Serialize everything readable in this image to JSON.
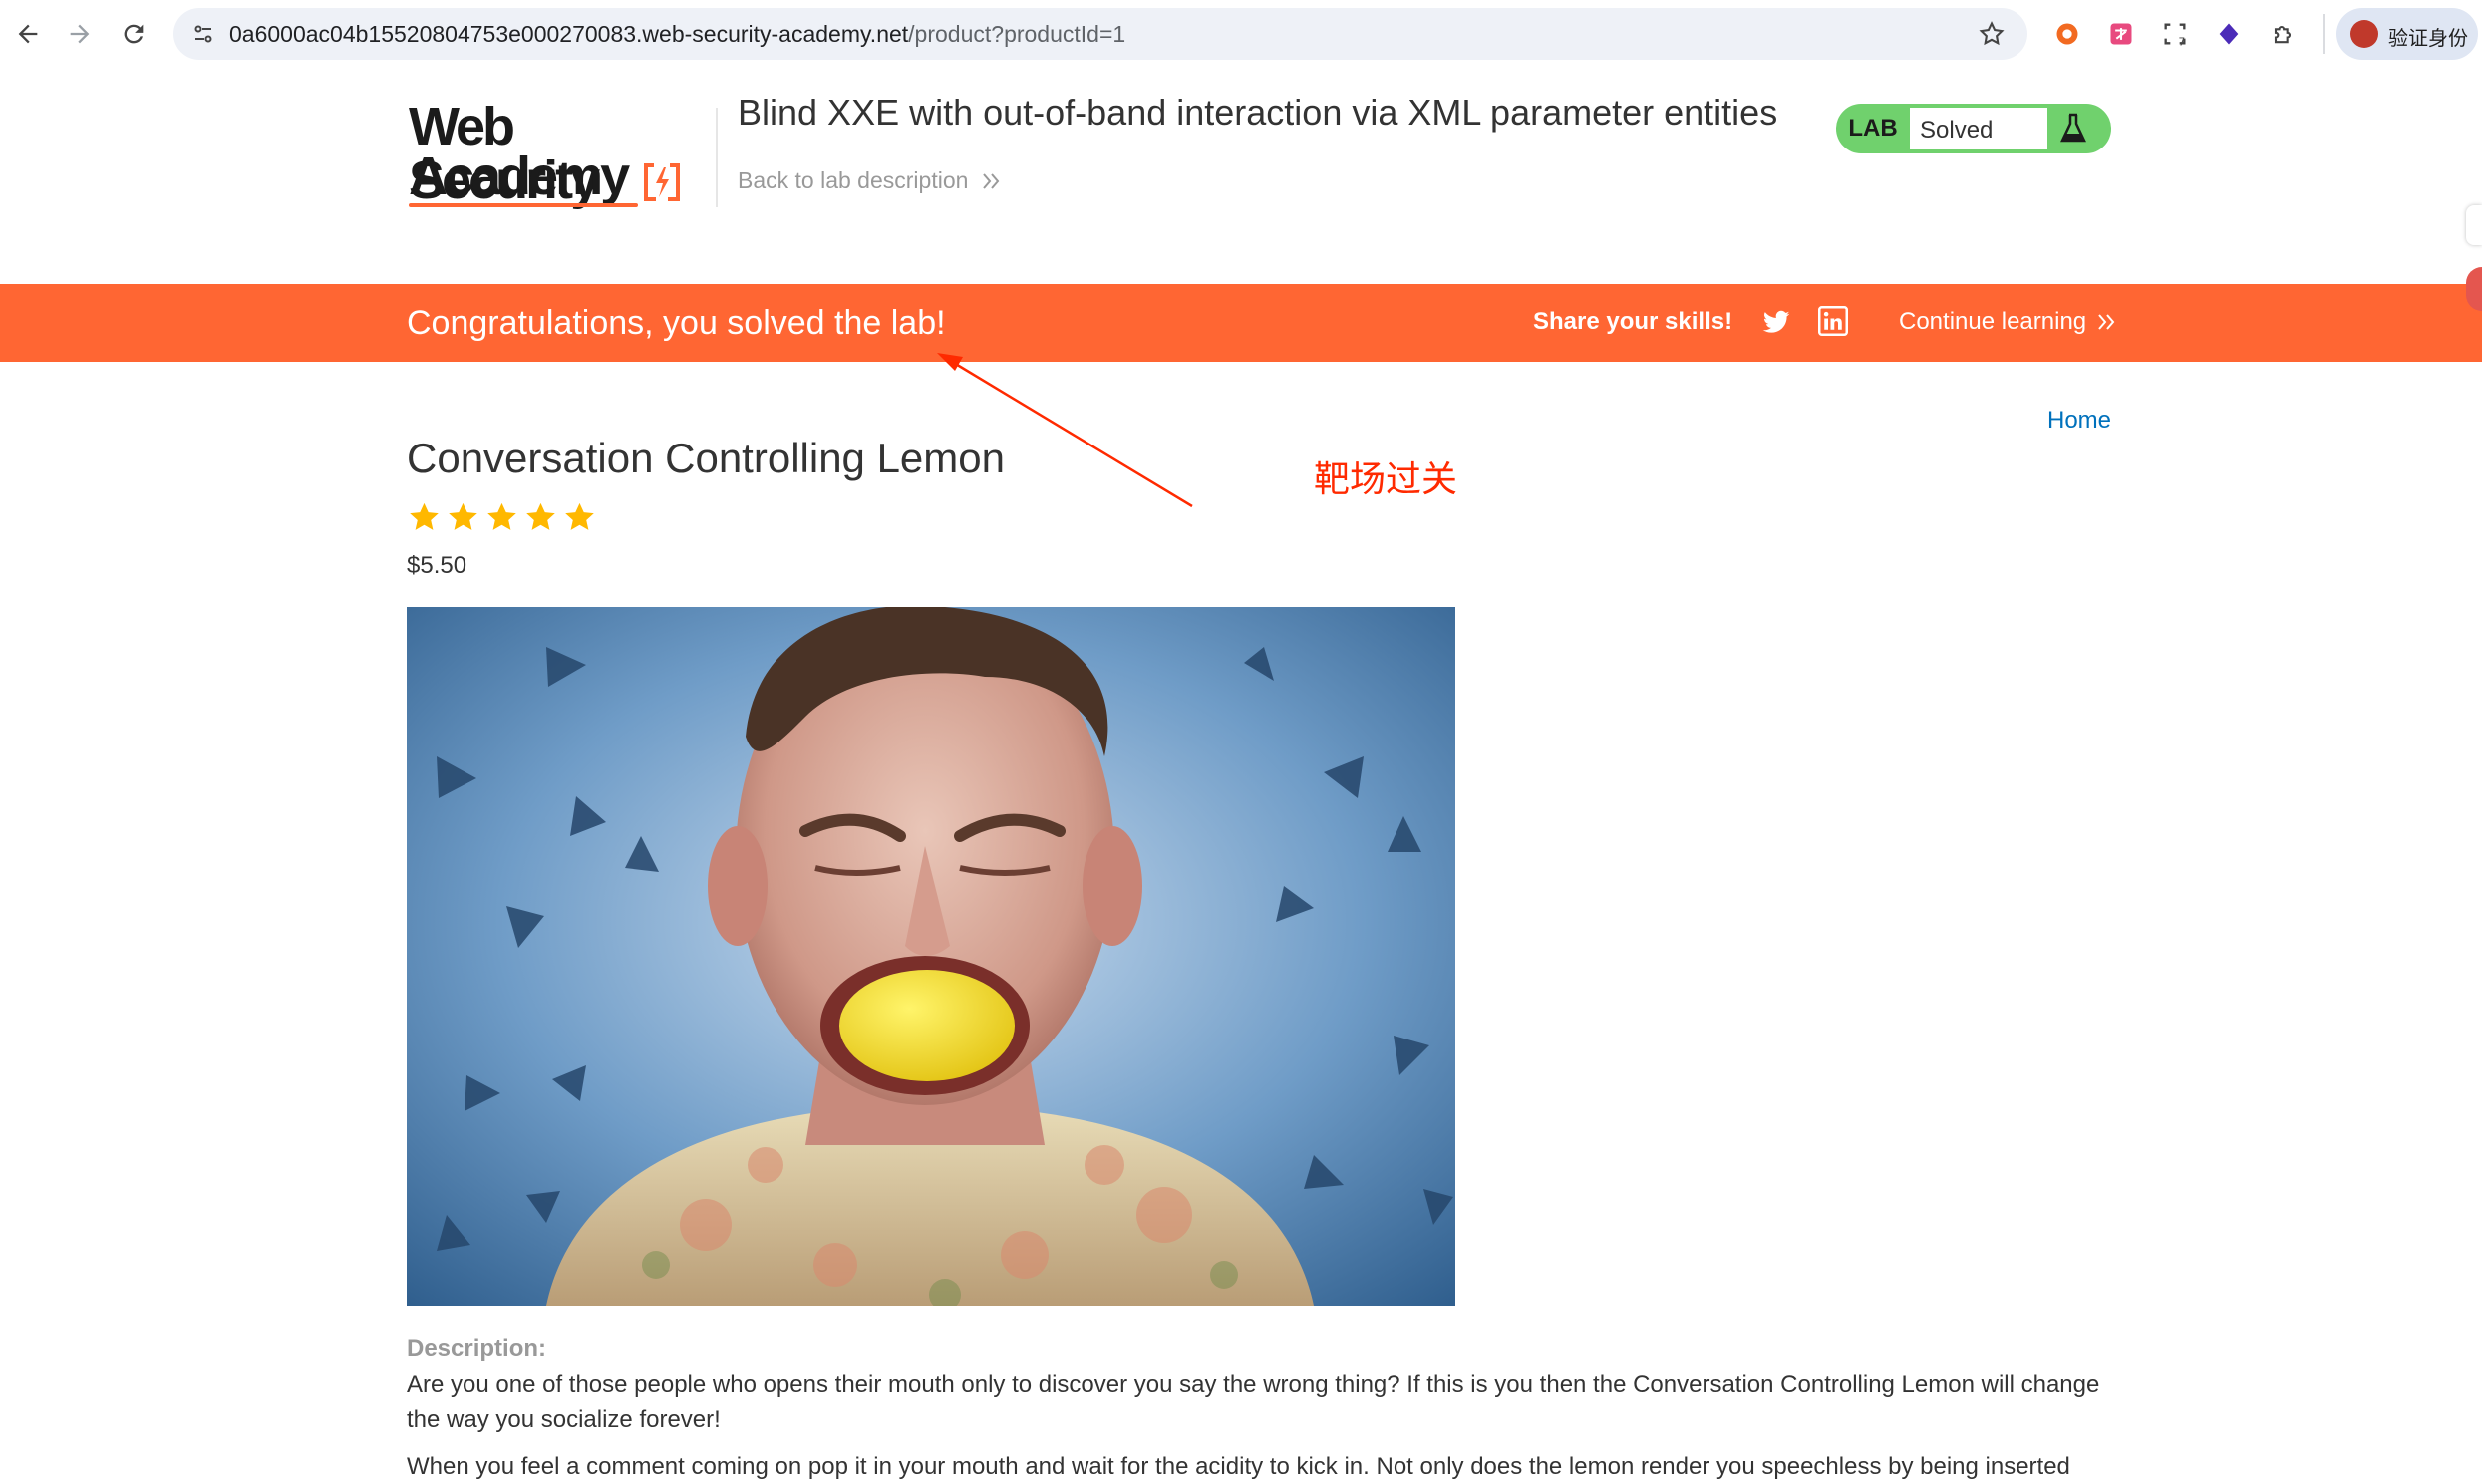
{
  "browser": {
    "url_host": "0a6000ac04b15520804753e000270083.web-security-academy.net",
    "url_path": "/product?productId=1",
    "profile_label": "验证身份",
    "colors": {
      "omnibox": "#eef1f7",
      "profile_bg": "#dfe6f3"
    }
  },
  "header": {
    "logo_line1": "Web Security",
    "logo_line2": "Academy",
    "lab_title": "Blind XXE with out-of-band interaction via XML parameter entities",
    "back_link": "Back to lab description",
    "badge": {
      "tag": "LAB",
      "status": "Solved",
      "color": "#70d16d"
    }
  },
  "banner": {
    "message": "Congratulations, you solved the lab!",
    "share_label": "Share your skills!",
    "continue_label": "Continue learning",
    "color": "#ff6633"
  },
  "product": {
    "home_link": "Home",
    "name": "Conversation Controlling Lemon",
    "rating": 5,
    "rating_max": 5,
    "price": "$5.50",
    "description_label": "Description:",
    "paragraph1": "Are you one of those people who opens their mouth only to discover you say the wrong thing? If this is you then the Conversation Controlling Lemon will change the way you socialize forever!",
    "paragraph2": "When you feel a comment coming on pop it in your mouth and wait for the acidity to kick in. Not only does the lemon render you speechless by being inserted"
  },
  "annotation": {
    "text": "靶场过关",
    "color": "#ff2a00"
  }
}
